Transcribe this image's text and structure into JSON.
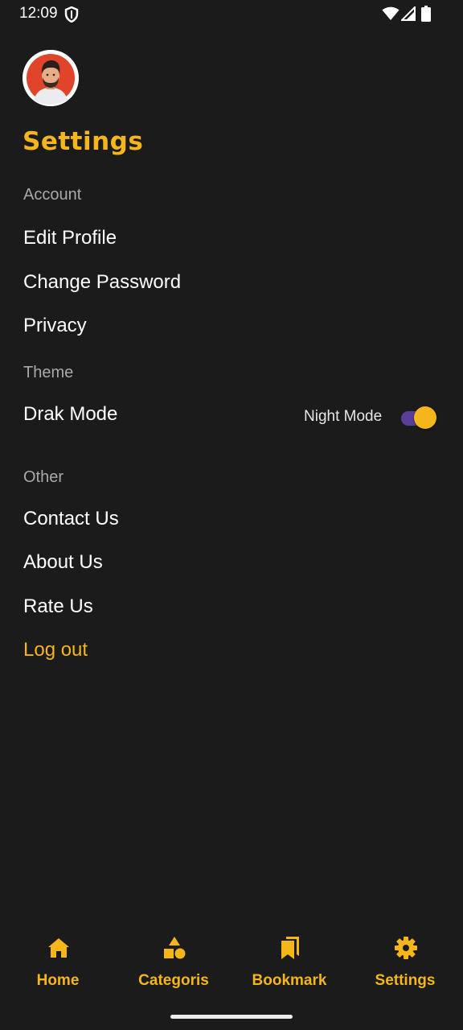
{
  "status_bar": {
    "time": "12:09"
  },
  "page": {
    "title": "Settings"
  },
  "sections": {
    "account": {
      "label": "Account",
      "items": [
        "Edit Profile",
        "Change Password",
        "Privacy"
      ]
    },
    "theme": {
      "label": "Theme",
      "dark_mode_label": "Drak Mode",
      "toggle_label": "Night Mode",
      "toggle_on": true
    },
    "other": {
      "label": "Other",
      "items": [
        "Contact Us",
        "About Us",
        "Rate Us"
      ],
      "logout": "Log out"
    }
  },
  "bottom_nav": {
    "items": [
      {
        "label": "Home",
        "icon": "home-icon"
      },
      {
        "label": "Categoris",
        "icon": "shapes-icon"
      },
      {
        "label": "Bookmark",
        "icon": "bookmark-icon"
      },
      {
        "label": "Settings",
        "icon": "gear-icon"
      }
    ]
  },
  "colors": {
    "background": "#1b1b1b",
    "accent": "#f4b61b",
    "toggle_track": "#5b3e9c",
    "section_label": "#a9a9a9"
  }
}
